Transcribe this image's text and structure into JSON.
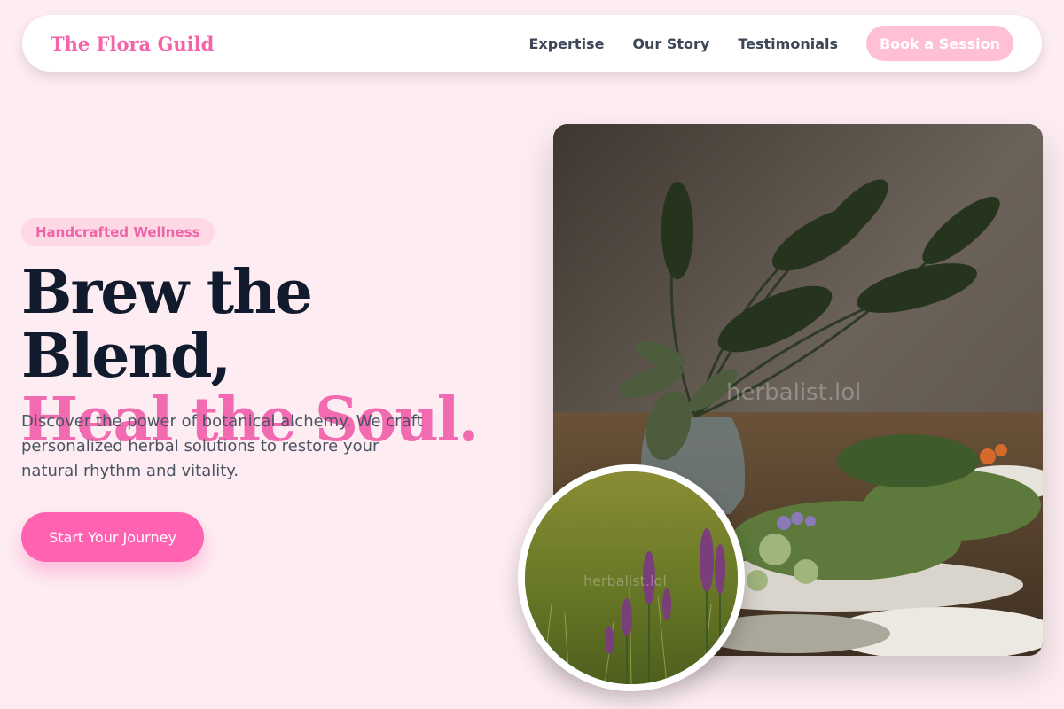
{
  "header": {
    "brand": "The Flora Guild",
    "nav": [
      "Expertise",
      "Our Story",
      "Testimonials"
    ],
    "cta_label": "Book a Session"
  },
  "hero": {
    "badge": "Handcrafted Wellness",
    "title_line1": "Brew the Blend,",
    "title_line2": "Heal the Soul.",
    "description": "Discover the power of botanical alchemy. We craft personalized herbal solutions to restore your natural rhythm and vitality.",
    "cta_label": "Start Your Journey"
  },
  "images": {
    "main_watermark": "herbalist.lol",
    "circle_watermark": "herbalist.lol"
  },
  "colors": {
    "background": "#fdedf2",
    "accent": "#f364a8",
    "cta": "#ff62b1",
    "book_button": "#ffc0d4",
    "heading_dark": "#121a2e"
  }
}
